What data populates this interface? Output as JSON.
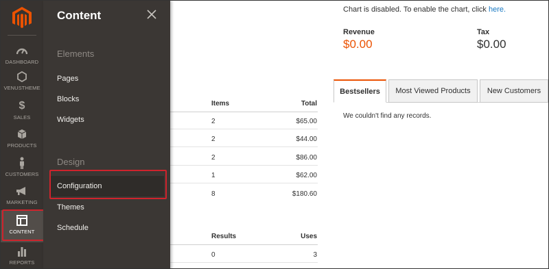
{
  "sidebar": {
    "items": [
      {
        "label": "DASHBOARD",
        "icon": "dashboard-icon"
      },
      {
        "label": "VENUSTHEME",
        "icon": "hexagon-icon"
      },
      {
        "label": "SALES",
        "icon": "dollar-icon"
      },
      {
        "label": "PRODUCTS",
        "icon": "box-icon"
      },
      {
        "label": "CUSTOMERS",
        "icon": "person-icon"
      },
      {
        "label": "MARKETING",
        "icon": "megaphone-icon"
      },
      {
        "label": "CONTENT",
        "icon": "layout-icon"
      },
      {
        "label": "REPORTS",
        "icon": "bar-chart-icon"
      }
    ],
    "active": "CONTENT"
  },
  "flyout": {
    "title": "Content",
    "sections": [
      {
        "heading": "Elements",
        "links": [
          "Pages",
          "Blocks",
          "Widgets"
        ]
      },
      {
        "heading": "Design",
        "links": [
          "Configuration",
          "Themes",
          "Schedule"
        ]
      }
    ],
    "highlighted": "Configuration"
  },
  "orders_table": {
    "headers": {
      "items": "Items",
      "total": "Total"
    },
    "rows": [
      {
        "items": "2",
        "total": "$65.00"
      },
      {
        "items": "2",
        "total": "$44.00"
      },
      {
        "items": "2",
        "total": "$86.00"
      },
      {
        "items": "1",
        "total": "$62.00"
      },
      {
        "items": "8",
        "total": "$180.60"
      }
    ]
  },
  "search_table": {
    "headers": {
      "results": "Results",
      "uses": "Uses"
    },
    "rows": [
      {
        "results": "0",
        "uses": "3"
      }
    ]
  },
  "chart": {
    "message": "Chart is disabled. To enable the chart, click ",
    "link": "here."
  },
  "stats": {
    "revenue": {
      "label": "Revenue",
      "value": "$0.00"
    },
    "tax": {
      "label": "Tax",
      "value": "$0.00"
    }
  },
  "tabs": {
    "items": [
      "Bestsellers",
      "Most Viewed Products",
      "New Customers"
    ],
    "active": "Bestsellers",
    "empty_message": "We couldn't find any records."
  },
  "colors": {
    "accent": "#eb5202",
    "highlight_border": "#d0232c",
    "link": "#1979c3",
    "nav_bg": "#373330"
  }
}
